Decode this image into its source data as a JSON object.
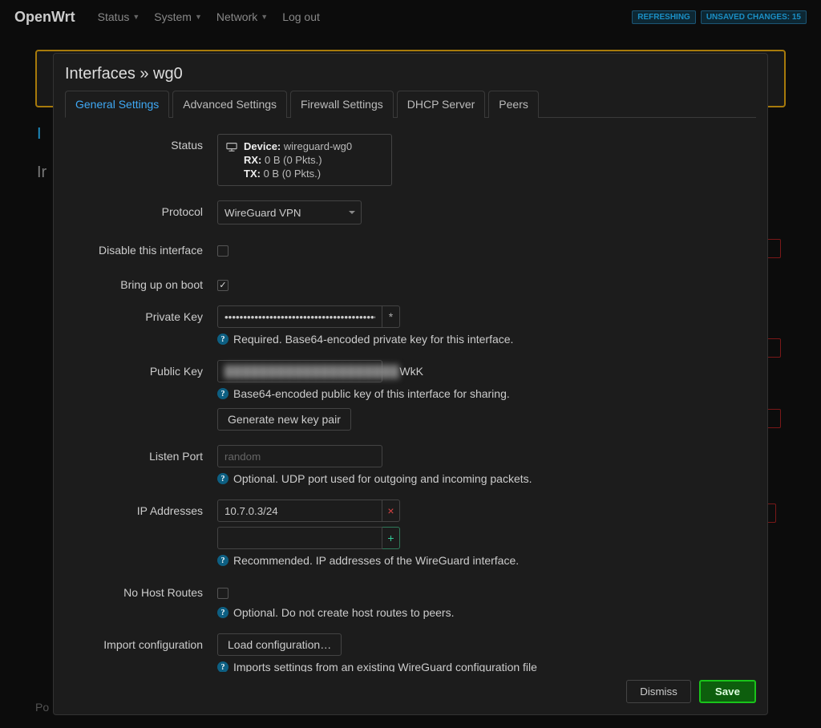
{
  "header": {
    "brand": "OpenWrt",
    "nav": [
      "Status",
      "System",
      "Network",
      "Log out"
    ],
    "badges": {
      "refreshing": "REFRESHING",
      "changes": "UNSAVED CHANGES: 15"
    }
  },
  "modal": {
    "title": "Interfaces » wg0",
    "tabs": [
      "General Settings",
      "Advanced Settings",
      "Firewall Settings",
      "DHCP Server",
      "Peers"
    ],
    "active_tab": 0,
    "labels": {
      "status": "Status",
      "protocol": "Protocol",
      "disable": "Disable this interface",
      "boot": "Bring up on boot",
      "privkey": "Private Key",
      "pubkey": "Public Key",
      "listen": "Listen Port",
      "ips": "IP Addresses",
      "nohost": "No Host Routes",
      "import": "Import configuration"
    },
    "status": {
      "device_label": "Device:",
      "device_value": "wireguard-wg0",
      "rx_label": "RX:",
      "rx_value": "0 B (0 Pkts.)",
      "tx_label": "TX:",
      "tx_value": "0 B (0 Pkts.)"
    },
    "protocol": "WireGuard VPN",
    "disable_checked": false,
    "boot_checked": true,
    "private_key_mask": "••••••••••••••••••••••••••••••••••••••••••••",
    "reveal_glyph": "*",
    "public_key_masked": "████████████████████",
    "public_key_suffix": "WkK",
    "listen_placeholder": "random",
    "ip_value": "10.7.0.3/24",
    "nohost_checked": false,
    "buttons": {
      "genkey": "Generate new key pair",
      "load": "Load configuration…",
      "remove": "×",
      "add": "+"
    },
    "hints": {
      "privkey": "Required. Base64-encoded private key for this interface.",
      "pubkey": "Base64-encoded public key of this interface for sharing.",
      "listen": "Optional. UDP port used for outgoing and incoming packets.",
      "ips": "Recommended. IP addresses of the WireGuard interface.",
      "nohost": "Optional. Do not create host routes to peers.",
      "import": "Imports settings from an existing WireGuard configuration file"
    },
    "footer": {
      "dismiss": "Dismiss",
      "save": "Save"
    }
  },
  "footer_hint": "Po",
  "bg_i_top": "I",
  "bg_i_mid": "Ir"
}
